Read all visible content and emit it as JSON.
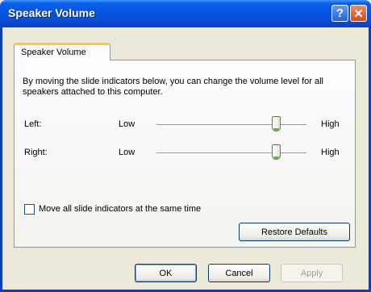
{
  "window": {
    "title": "Speaker Volume",
    "help_icon": "help-icon",
    "close_icon": "close-icon"
  },
  "tab": {
    "label": "Speaker Volume"
  },
  "description": "By moving the slide indicators below, you can change the volume level for all speakers attached to this computer.",
  "sliders": [
    {
      "label": "Left:",
      "low": "Low",
      "high": "High",
      "level": 0.8
    },
    {
      "label": "Right:",
      "low": "Low",
      "high": "High",
      "level": 0.8
    }
  ],
  "move_all": {
    "label": "Move all slide indicators at the same time",
    "checked": false
  },
  "restore_defaults": "Restore Defaults",
  "buttons": {
    "ok": "OK",
    "cancel": "Cancel",
    "apply": "Apply"
  }
}
